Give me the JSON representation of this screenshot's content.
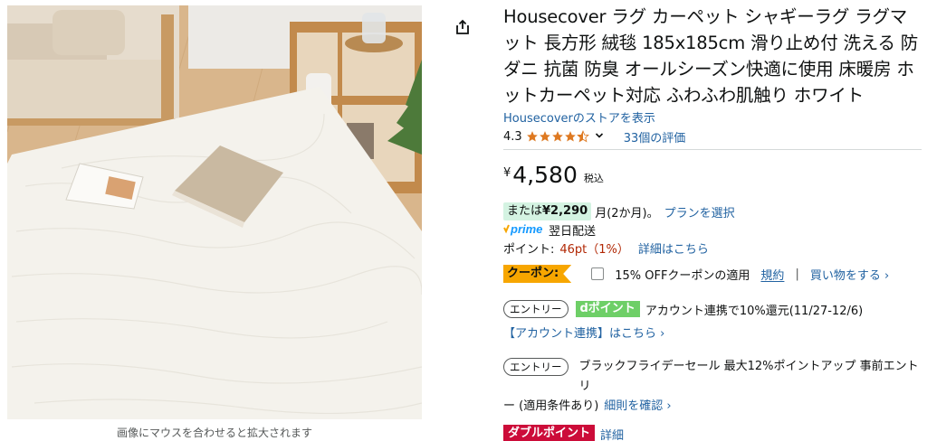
{
  "image": {
    "hover_hint": "画像にマウスを合わせると拡大されます"
  },
  "share": {
    "icon": "share-icon"
  },
  "product": {
    "title": "Housecover ラグ カーペット シャギーラグ ラグマット 長方形 絨毯 185x185cm 滑り止め付 洗える 防ダニ 抗菌 防臭 オールシーズン快適に使用 床暖房 ホットカーペット対応 ふわふわ肌触り ホワイト",
    "store_link": "Housecoverのストアを表示",
    "rating": "4.3",
    "rating_value": 4.3,
    "reviews": "33個の評価"
  },
  "price": {
    "symbol": "¥",
    "value": "4,580",
    "tax": "税込"
  },
  "installment": {
    "prefix": "または",
    "amount": "¥2,290",
    "months": "月(2か月)。",
    "plan_link": "プランを選択"
  },
  "prime": {
    "logo": "prime",
    "delivery": "翌日配送"
  },
  "points": {
    "label": "ポイント:",
    "value": "46pt（1%）",
    "detail_link": "詳細はこちら"
  },
  "coupon": {
    "badge": "クーポン:",
    "text": "15% OFFクーポンの適用",
    "terms_link": "規約",
    "separator": "|",
    "shop_link": "買い物をする ›"
  },
  "entry1": {
    "badge": "エントリー",
    "dpoint": "dポイント",
    "text": "アカウント連携で10%還元(11/27-12/6)",
    "link": "【アカウント連携】はこちら ›"
  },
  "entry2": {
    "badge": "エントリー",
    "text": "ブラックフライデーセール 最大12%ポイントアップ 事前エントリ",
    "text2": "ー (適用条件あり)",
    "link": "細則を確認 ›"
  },
  "double_point": {
    "badge": "ダブルポイント",
    "link": "詳細"
  },
  "colors": {
    "link": "#2162a1",
    "star": "#de7921",
    "coupon": "#f7a600",
    "dpoint": "#6ecf67",
    "double": "#cc0c39",
    "install_bg": "#d4f3e2"
  }
}
